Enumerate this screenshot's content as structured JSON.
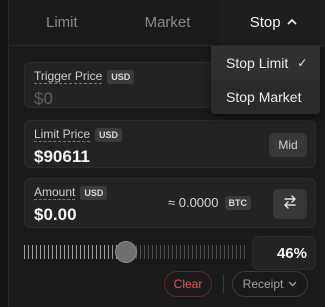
{
  "tabs": [
    {
      "label": "Limit"
    },
    {
      "label": "Market"
    },
    {
      "label": "Stop"
    }
  ],
  "dropdown": {
    "items": [
      {
        "label": "Stop Limit",
        "check": "✓"
      },
      {
        "label": "Stop Market"
      }
    ]
  },
  "trigger": {
    "label": "Trigger Price",
    "currency": "USD",
    "placeholder": "$0"
  },
  "limit": {
    "label": "Limit Price",
    "currency": "USD",
    "value": "$90611",
    "mid_label": "Mid"
  },
  "amount": {
    "label": "Amount",
    "currency": "USD",
    "value": "$0.00",
    "converted": "≈ 0.0000",
    "converted_currency": "BTC"
  },
  "slider": {
    "percent": 46,
    "percent_label": "46%"
  },
  "actions": {
    "clear_label": "Clear",
    "receipt_label": "Receipt"
  },
  "colors": {
    "clear": "#e05a5a",
    "background": "#1a1a1a"
  },
  "icons": {
    "tab_chevron": "chevron-up-icon",
    "swap": "swap-arrows-icon",
    "receipt_chevron": "chevron-down-icon"
  }
}
